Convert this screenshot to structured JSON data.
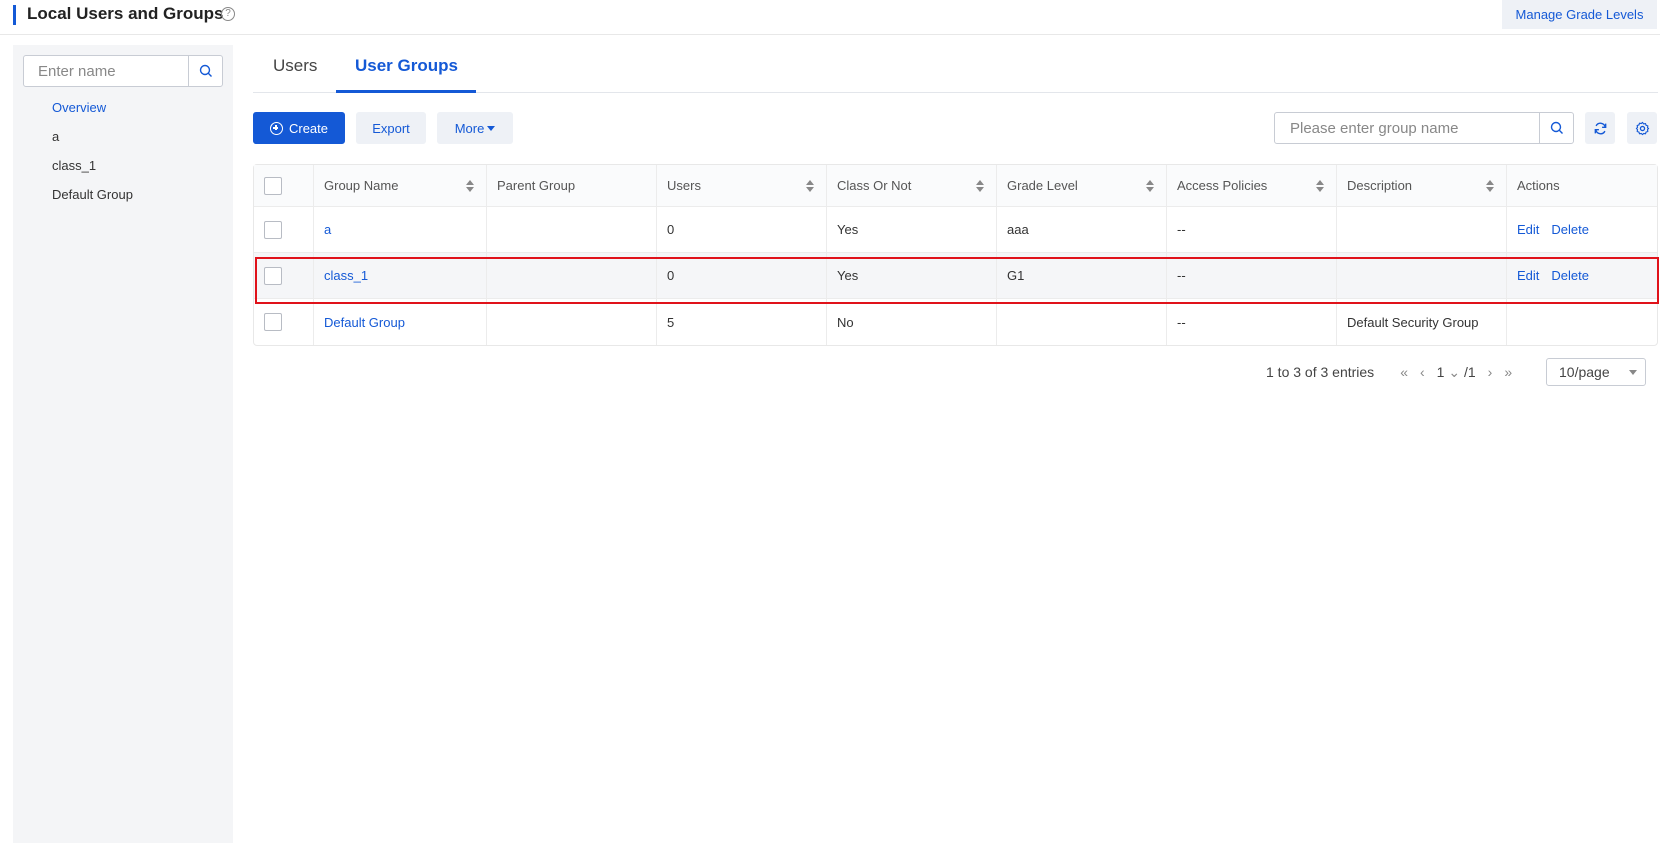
{
  "header": {
    "title": "Local Users and Groups",
    "help": "?",
    "manage_grade_levels": "Manage Grade Levels"
  },
  "sidebar": {
    "search_placeholder": "Enter name",
    "items": [
      {
        "label": "Overview"
      },
      {
        "label": "a"
      },
      {
        "label": "class_1"
      },
      {
        "label": "Default Group"
      }
    ]
  },
  "tabs": {
    "users": "Users",
    "user_groups": "User Groups"
  },
  "toolbar": {
    "create": "Create",
    "export": "Export",
    "more": "More",
    "search_placeholder": "Please enter group name"
  },
  "table": {
    "headers": [
      "Group Name",
      "Parent Group",
      "Users",
      "Class Or Not",
      "Grade Level",
      "Access Policies",
      "Description",
      "Actions"
    ],
    "rows": [
      {
        "group_name": "a",
        "parent_group": "",
        "users": "0",
        "class_or_not": "Yes",
        "grade_level": "aaa",
        "access_policies": "--",
        "description": "",
        "edit": "Edit",
        "delete": "Delete"
      },
      {
        "group_name": "class_1",
        "parent_group": "",
        "users": "0",
        "class_or_not": "Yes",
        "grade_level": "G1",
        "access_policies": "--",
        "description": "",
        "edit": "Edit",
        "delete": "Delete"
      },
      {
        "group_name": "Default Group",
        "parent_group": "",
        "users": "5",
        "class_or_not": "No",
        "grade_level": "",
        "access_policies": "--",
        "description": "Default Security Group",
        "edit": "",
        "delete": ""
      }
    ]
  },
  "pagination": {
    "entries": "1 to 3 of 3 entries",
    "current_page": "1",
    "total_pages": "/1",
    "per_page": "10/page"
  },
  "colors": {
    "accent": "#1459d6",
    "highlight": "#e0121a"
  }
}
